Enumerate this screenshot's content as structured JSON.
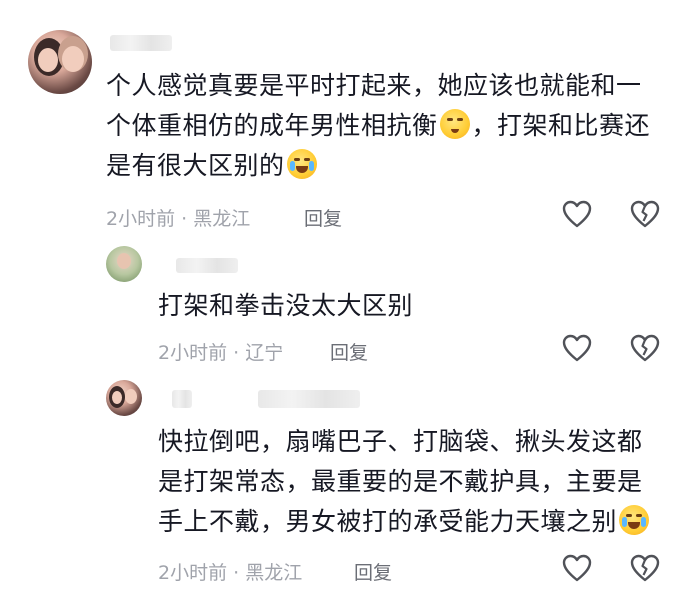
{
  "comments": [
    {
      "lines": [
        "个人感觉真要是平时打起来，她应该也就能和一",
        "个体重相仿的成年男性相抗衡",
        "，打架和比赛还",
        "是有很大区别的"
      ],
      "emoji_icons": [
        "dizzy-face-icon",
        "laughing-crying-icon"
      ],
      "time": "2小时前",
      "separator": "·",
      "location": "黑龙江",
      "reply_label": "回复"
    },
    {
      "lines": [
        "打架和拳击没太大区别"
      ],
      "time": "2小时前",
      "separator": "·",
      "location": "辽宁",
      "reply_label": "回复"
    },
    {
      "lines": [
        "快拉倒吧，扇嘴巴子、打脑袋、揪头发这都",
        "是打架常态，最重要的是不戴护具，主要是",
        "手上不戴，男女被打的承受能力天壤之别"
      ],
      "emoji_icons": [
        "laughing-crying-icon"
      ],
      "time": "2小时前",
      "separator": "·",
      "location": "黑龙江",
      "reply_label": "回复"
    }
  ],
  "icons": {
    "like": "heart-outline-icon",
    "dislike": "broken-heart-icon"
  },
  "colors": {
    "text": "#161823",
    "meta": "#a0a3ab",
    "reply": "#6b6e76",
    "icon_stroke": "#505258"
  }
}
